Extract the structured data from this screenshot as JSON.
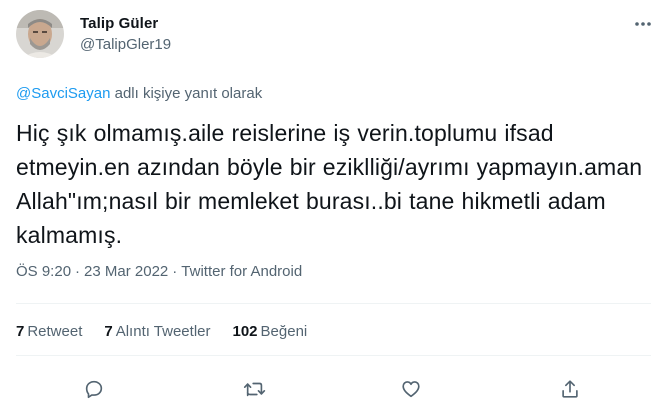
{
  "author": {
    "display_name": "Talip Güler",
    "handle": "@TalipGler19",
    "avatar": "profile-photo"
  },
  "reply": {
    "mention": "@SavciSayan",
    "suffix": " adlı kişiye yanıt olarak"
  },
  "tweet": {
    "text": "Hiç şık olmamış.aile reislerine iş verin.toplumu ifsad etmeyin.en azından böyle bir eziklliği/ayrımı yapmayın.aman Allah\"ım;nasıl bir memleket burası..bi tane hikmetli adam kalmamış."
  },
  "meta": {
    "time": "ÖS 9:20",
    "separator": "·",
    "date": "23 Mar 2022",
    "source": "Twitter for Android"
  },
  "stats": {
    "retweets": {
      "count": "7",
      "label": "Retweet"
    },
    "quotes": {
      "count": "7",
      "label": "Alıntı Tweetler"
    },
    "likes": {
      "count": "102",
      "label": "Beğeni"
    }
  },
  "actions": [
    "reply-icon",
    "retweet-icon",
    "like-icon",
    "share-icon"
  ],
  "colors": {
    "text": "#0f1419",
    "secondary": "#536471",
    "accent": "#1d9bf0",
    "divider": "#eff3f4"
  }
}
